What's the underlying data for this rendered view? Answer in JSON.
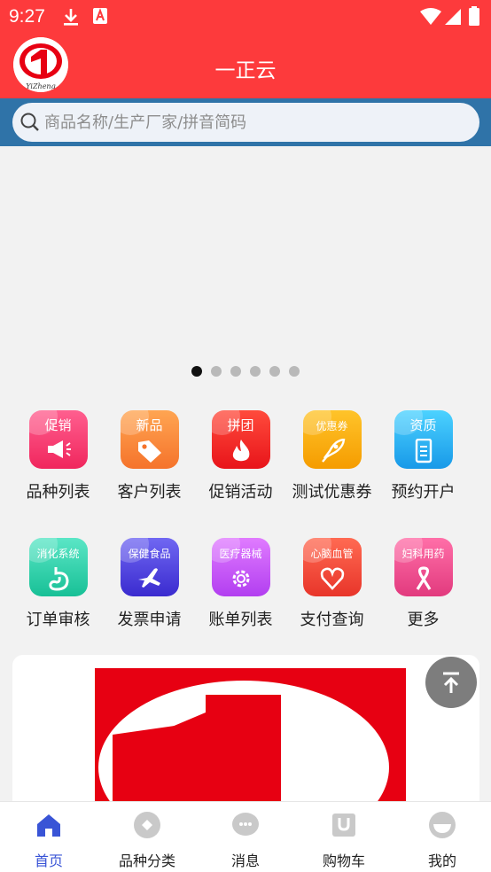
{
  "status_bar": {
    "time": "9:27"
  },
  "header": {
    "title": "一正云",
    "logo_text": "YiZheng"
  },
  "search": {
    "placeholder": "商品名称/生产厂家/拼音简码"
  },
  "banner": {
    "dot_count": 6,
    "active_index": 0
  },
  "grid": {
    "items": [
      {
        "tag": "促销",
        "label": "品种列表",
        "icon": "megaphone-icon",
        "color_top": "#ff5f8f",
        "color_bottom": "#f0265d"
      },
      {
        "tag": "新品",
        "label": "客户列表",
        "icon": "price-tag-icon",
        "color_top": "#ffa552",
        "color_bottom": "#f5732b"
      },
      {
        "tag": "拼团",
        "label": "促销活动",
        "icon": "flame-icon",
        "color_top": "#ff4b3c",
        "color_bottom": "#e8141a"
      },
      {
        "tag": "优惠券",
        "label": "测试优惠券",
        "icon": "rocket-icon",
        "color_top": "#ffc42a",
        "color_bottom": "#f59c00"
      },
      {
        "tag": "资质",
        "label": "预约开户",
        "icon": "document-icon",
        "color_top": "#4cd2ff",
        "color_bottom": "#1899e8"
      },
      {
        "tag": "消化系统",
        "label": "订单审核",
        "icon": "stomach-icon",
        "color_top": "#5be6c6",
        "color_bottom": "#17c096"
      },
      {
        "tag": "保健食品",
        "label": "发票申请",
        "icon": "airplane-icon",
        "color_top": "#7067f2",
        "color_bottom": "#3a2bcf"
      },
      {
        "tag": "医疗器械",
        "label": "账单列表",
        "icon": "gear-icon",
        "color_top": "#e07bff",
        "color_bottom": "#b23ef0"
      },
      {
        "tag": "心脑血管",
        "label": "支付查询",
        "icon": "heart-icon",
        "color_top": "#ff6a52",
        "color_bottom": "#e8352a"
      },
      {
        "tag": "妇科用药",
        "label": "更多",
        "icon": "ribbon-icon",
        "color_top": "#ff6fa8",
        "color_bottom": "#e23a7e"
      }
    ]
  },
  "bottom_nav": {
    "items": [
      {
        "label": "首页",
        "icon": "home-icon",
        "active": true
      },
      {
        "label": "品种分类",
        "icon": "category-icon",
        "active": false
      },
      {
        "label": "消息",
        "icon": "chat-icon",
        "active": false
      },
      {
        "label": "购物车",
        "icon": "cart-icon",
        "active": false
      },
      {
        "label": "我的",
        "icon": "profile-icon",
        "active": false
      }
    ]
  },
  "colors": {
    "header_red": "#fd3a3c",
    "search_band": "#2f73a8",
    "nav_active": "#3954d6",
    "nav_inactive_icon": "#c9c9c9",
    "promo_red": "#e70012"
  }
}
